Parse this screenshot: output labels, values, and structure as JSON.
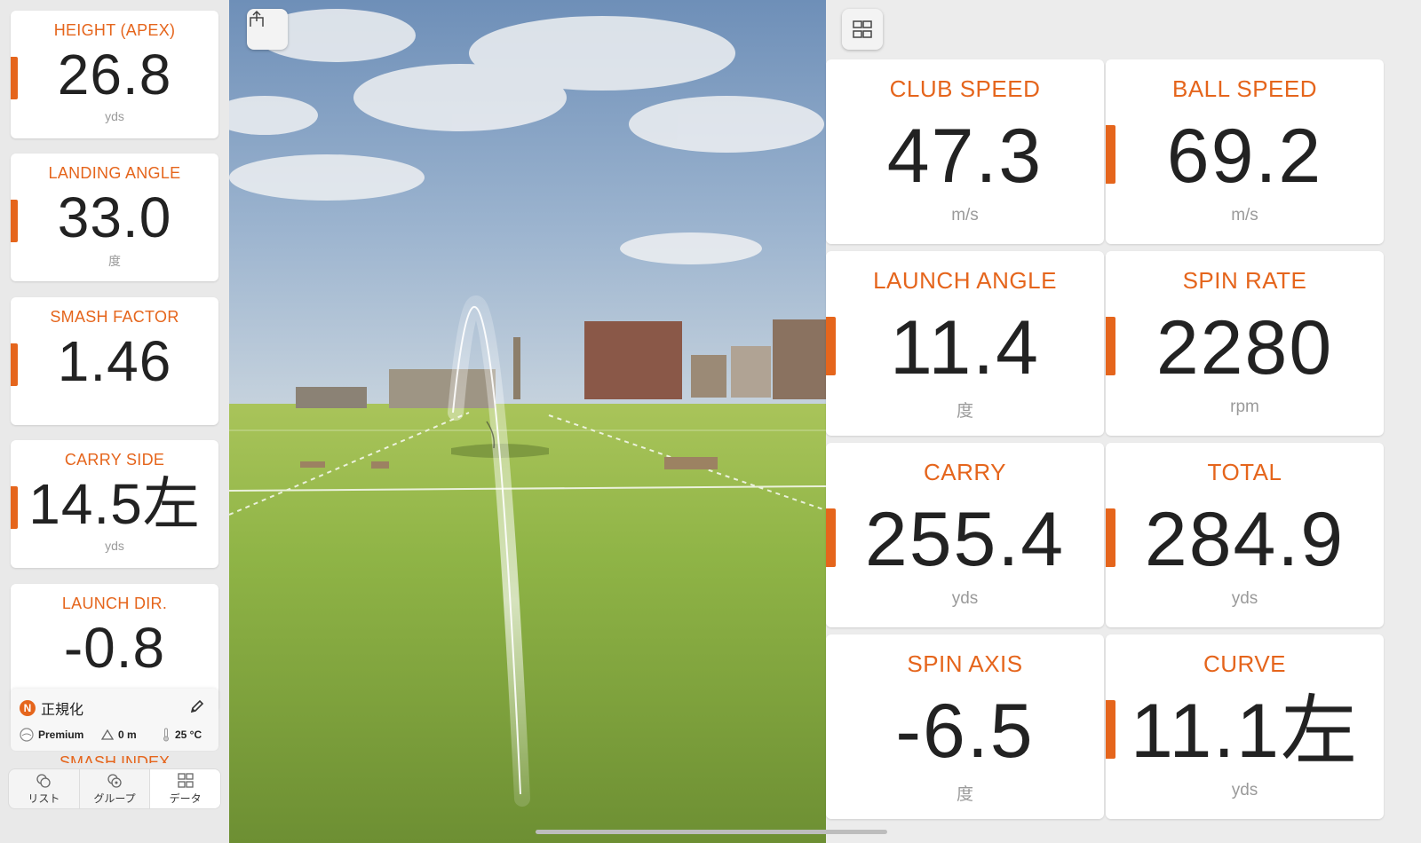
{
  "left_metrics": [
    {
      "title": "HEIGHT (APEX)",
      "value": "26.8",
      "unit": "yds",
      "normalized": true
    },
    {
      "title": "LANDING ANGLE",
      "value": "33.0",
      "unit": "度",
      "normalized": true
    },
    {
      "title": "SMASH FACTOR",
      "value": "1.46",
      "unit": "",
      "normalized": true
    },
    {
      "title": "CARRY SIDE",
      "value": "14.5左",
      "unit": "yds",
      "normalized": true
    },
    {
      "title": "LAUNCH DIR.",
      "value": "-0.8",
      "unit": "",
      "normalized": false
    }
  ],
  "normalize_panel": {
    "badge": "N",
    "label": "正規化",
    "ball": "Premium",
    "altitude": "0 m",
    "temperature": "25 °C"
  },
  "smash_index_peek": "SMASH INDEX",
  "bottom_tabs": [
    {
      "label": "リスト",
      "icon": "list-balls-icon"
    },
    {
      "label": "グループ",
      "icon": "group-balls-icon"
    },
    {
      "label": "データ",
      "icon": "data-grid-icon"
    }
  ],
  "right_metrics": [
    {
      "title": "CLUB SPEED",
      "value": "47.3",
      "unit": "m/s",
      "normalized": false
    },
    {
      "title": "BALL SPEED",
      "value": "69.2",
      "unit": "m/s",
      "normalized": true
    },
    {
      "title": "LAUNCH ANGLE",
      "value": "11.4",
      "unit": "度",
      "normalized": true
    },
    {
      "title": "SPIN RATE",
      "value": "2280",
      "unit": "rpm",
      "normalized": true
    },
    {
      "title": "CARRY",
      "value": "255.4",
      "unit": "yds",
      "normalized": true
    },
    {
      "title": "TOTAL",
      "value": "284.9",
      "unit": "yds",
      "normalized": true
    },
    {
      "title": "SPIN AXIS",
      "value": "-6.5",
      "unit": "度",
      "normalized": false
    },
    {
      "title": "CURVE",
      "value": "11.1左",
      "unit": "yds",
      "normalized": true
    }
  ],
  "normalize_tab_text": "正規化",
  "colors": {
    "accent": "#e5651c",
    "value_text": "#222222",
    "unit_text": "#9a9a9a"
  },
  "icons": {
    "share": "share-icon",
    "layout": "layout-grid-icon",
    "edit": "pencil-icon",
    "ball": "ball-icon",
    "altitude": "altitude-icon",
    "temperature": "thermometer-icon"
  }
}
